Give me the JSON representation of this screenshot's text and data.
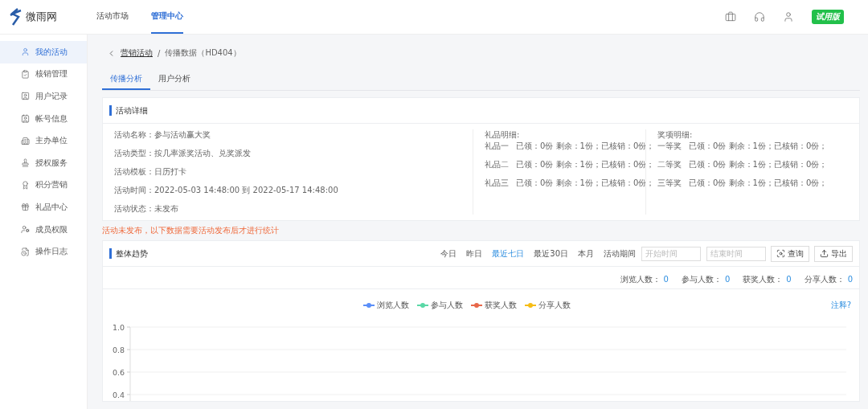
{
  "header": {
    "logo_text": "微雨网",
    "nav": [
      {
        "label": "活动市场",
        "selected": false
      },
      {
        "label": "管理中心",
        "selected": true
      }
    ],
    "badge": "试用版"
  },
  "sidebar": {
    "items": [
      {
        "label": "我的活动",
        "selected": true
      },
      {
        "label": "核销管理",
        "selected": false
      },
      {
        "label": "用户记录",
        "selected": false
      },
      {
        "label": "帐号信息",
        "selected": false
      },
      {
        "label": "主办单位",
        "selected": false
      },
      {
        "label": "授权服务",
        "selected": false
      },
      {
        "label": "积分营销",
        "selected": false
      },
      {
        "label": "礼品中心",
        "selected": false
      },
      {
        "label": "成员权限",
        "selected": false
      },
      {
        "label": "操作日志",
        "selected": false
      }
    ]
  },
  "breadcrumb": {
    "parent": "营销活动",
    "separator": "/",
    "current": "传播数据（HD404）"
  },
  "tabs": [
    {
      "label": "传播分析",
      "selected": true
    },
    {
      "label": "用户分析",
      "selected": false
    }
  ],
  "detail": {
    "title": "活动详细",
    "fields": [
      {
        "label": "活动名称：",
        "value": "参与活动赢大奖"
      },
      {
        "label": "活动类型：",
        "value": "按几率派奖活动、兑奖派发"
      },
      {
        "label": "活动模板：",
        "value": "日历打卡"
      },
      {
        "label": "活动时间：",
        "value": "2022-05-03 14:48:00 到 2022-05-17 14:48:00"
      },
      {
        "label": "活动状态：",
        "value": "未发布"
      }
    ],
    "gifts": {
      "title": "礼品明细:",
      "rows": [
        {
          "name": "礼品一",
          "text": "已领：0份 剩余：1份；已核销：0份；"
        },
        {
          "name": "礼品二",
          "text": "已领：0份 剩余：1份；已核销：0份；"
        },
        {
          "name": "礼品三",
          "text": "已领：0份 剩余：1份；已核销：0份；"
        }
      ]
    },
    "prizes": {
      "title": "奖项明细:",
      "rows": [
        {
          "name": "一等奖",
          "text": "已领：0份 剩余：1份；已核销：0份；"
        },
        {
          "name": "二等奖",
          "text": "已领：0份 剩余：1份；已核销：0份；"
        },
        {
          "name": "三等奖",
          "text": "已领：0份 剩余：1份；已核销：0份；"
        }
      ]
    }
  },
  "notice": "活动未发布，以下数据需要活动发布后才进行统计",
  "trend": {
    "title": "整体趋势",
    "ranges": [
      {
        "label": "今日",
        "selected": false
      },
      {
        "label": "昨日",
        "selected": false
      },
      {
        "label": "最近七日",
        "selected": true
      },
      {
        "label": "最近30日",
        "selected": false
      },
      {
        "label": "本月",
        "selected": false
      },
      {
        "label": "活动期间",
        "selected": false
      }
    ],
    "start_placeholder": "开始时间",
    "end_placeholder": "结束时间",
    "query_button": "查询",
    "export_button": "导出",
    "stats": [
      {
        "label": "浏览人数：",
        "value": "0"
      },
      {
        "label": "参与人数：",
        "value": "0"
      },
      {
        "label": "获奖人数：",
        "value": "0"
      },
      {
        "label": "分享人数：",
        "value": "0"
      }
    ],
    "note_link": "注释?",
    "chart_data": {
      "type": "line",
      "ylim": [
        0.4,
        1.0
      ],
      "yticks": [
        {
          "value": 0.4,
          "label": "0.4"
        },
        {
          "value": 0.6,
          "label": "0.6"
        },
        {
          "value": 0.8,
          "label": "0.8"
        },
        {
          "value": 1.0,
          "label": "1.0"
        }
      ],
      "series": [
        {
          "name": "浏览人数",
          "color": "#5b8ff9"
        },
        {
          "name": "参与人数",
          "color": "#5ad8a6"
        },
        {
          "name": "获奖人数",
          "color": "#e8684a"
        },
        {
          "name": "分享人数",
          "color": "#f6bd16"
        }
      ]
    }
  }
}
